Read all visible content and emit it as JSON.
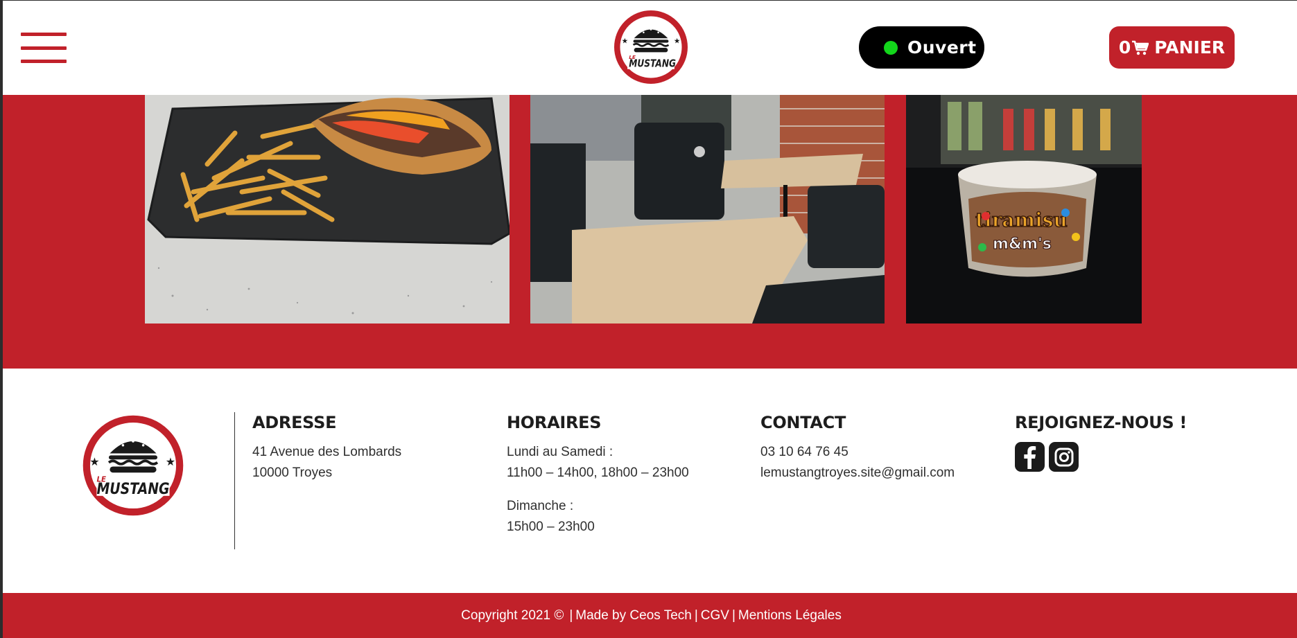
{
  "colors": {
    "brand_red": "#c1212a",
    "open_green": "#13d61b",
    "dark": "#1d1d1d"
  },
  "header": {
    "menu_icon": "hamburger-icon",
    "logo_text_top": "LE",
    "logo_text_main": "MUSTANG",
    "status_label": "Ouvert",
    "cart_count": "0",
    "cart_icon": "cart-icon",
    "cart_label": "PANIER"
  },
  "gallery": {
    "photos": [
      "sandwich-fries-photo",
      "restaurant-interior-photo",
      "tiramisu-mm-photo"
    ],
    "tiramisu_text": "tiramisu",
    "mm_text": "m&m's"
  },
  "footer": {
    "logo_text_top": "LE",
    "logo_text_main": "MUSTANG",
    "address": {
      "title": "ADRESSE",
      "line1": "41 Avenue des Lombards",
      "line2": "10000 Troyes"
    },
    "hours": {
      "title": "HORAIRES",
      "weekdays_label": "Lundi au Samedi :",
      "weekdays_hours": "11h00 – 14h00, 18h00 – 23h00",
      "sunday_label": "Dimanche :",
      "sunday_hours": "15h00 – 23h00"
    },
    "contact": {
      "title": "CONTACT",
      "phone": "03 10 64 76 45",
      "email": "lemustangtroyes.site@gmail.com"
    },
    "social": {
      "title": "REJOIGNEZ-NOUS !",
      "icons": [
        "facebook-icon",
        "instagram-icon"
      ]
    }
  },
  "bottom_bar": {
    "copyright": "Copyright 2021 ©",
    "sep": "|",
    "made_by": "Made by Ceos Tech",
    "cgv": "CGV",
    "legal": "Mentions Légales"
  }
}
